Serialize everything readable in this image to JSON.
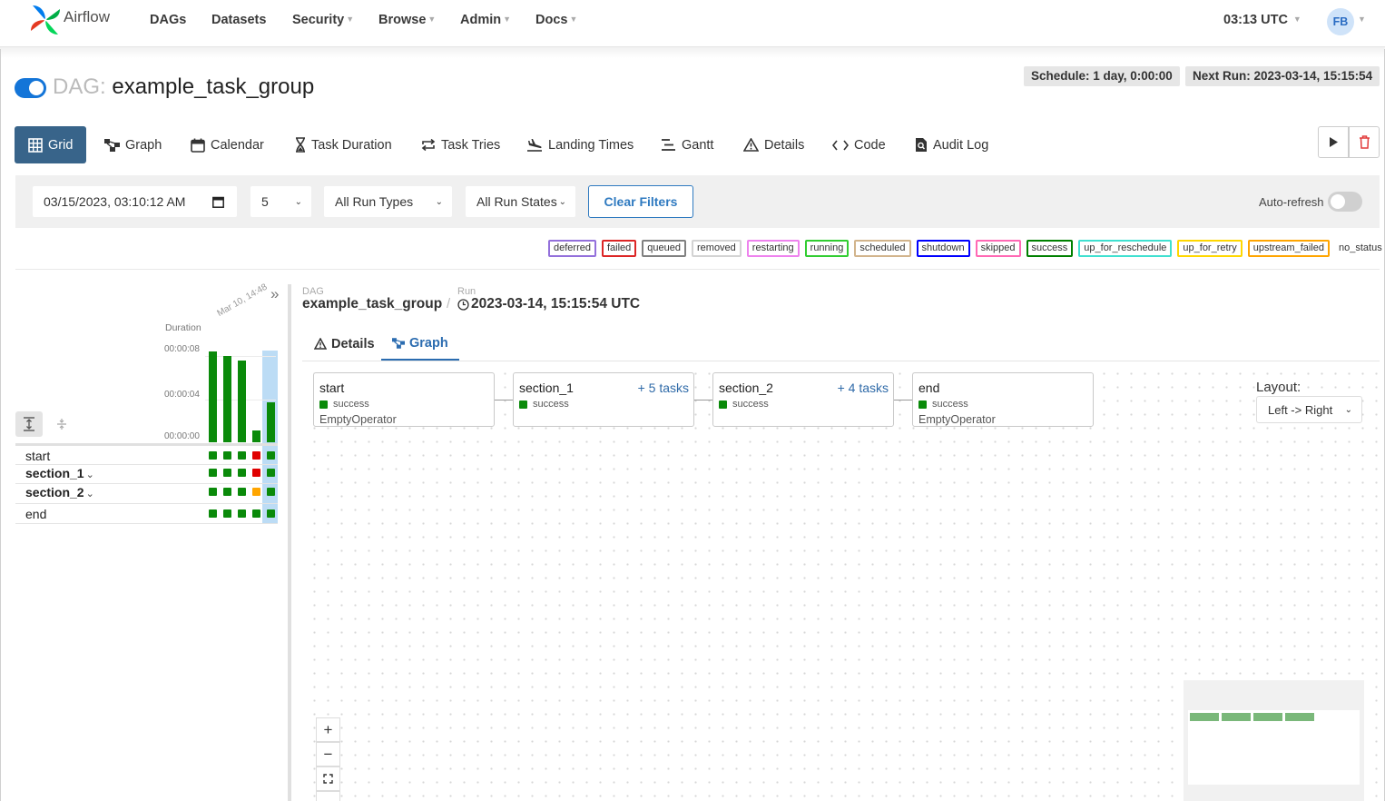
{
  "app": {
    "name": "Airflow",
    "nav": [
      "DAGs",
      "Datasets",
      "Security",
      "Browse",
      "Admin",
      "Docs"
    ],
    "clock": "03:13 UTC",
    "user_initials": "FB"
  },
  "dag": {
    "prefix": "DAG:",
    "name": "example_task_group",
    "paused": false,
    "schedule": "Schedule: 1 day, 0:00:00",
    "next_run": "Next Run: 2023-03-14, 15:15:54"
  },
  "tabs": {
    "grid": "Grid",
    "graph": "Graph",
    "calendar": "Calendar",
    "task_duration": "Task Duration",
    "task_tries": "Task Tries",
    "landing_times": "Landing Times",
    "gantt": "Gantt",
    "details": "Details",
    "code": "Code",
    "audit_log": "Audit Log"
  },
  "filters": {
    "date": "03/15/2023, 03:10:12 AM",
    "num_runs": "5",
    "run_types": "All Run Types",
    "run_states": "All Run States",
    "clear": "Clear Filters",
    "autorefresh": "Auto-refresh",
    "autorefresh_on": false
  },
  "legend": [
    {
      "label": "deferred",
      "color": "#9370db"
    },
    {
      "label": "failed",
      "color": "#dc2626"
    },
    {
      "label": "queued",
      "color": "#808080"
    },
    {
      "label": "removed",
      "color": "#d3d3d3"
    },
    {
      "label": "restarting",
      "color": "#ee82ee"
    },
    {
      "label": "running",
      "color": "#32cd32"
    },
    {
      "label": "scheduled",
      "color": "#d2b48c"
    },
    {
      "label": "shutdown",
      "color": "#0000ff"
    },
    {
      "label": "skipped",
      "color": "#ff69b4"
    },
    {
      "label": "success",
      "color": "#008000"
    },
    {
      "label": "up_for_reschedule",
      "color": "#40e0d0"
    },
    {
      "label": "up_for_retry",
      "color": "#ffd700"
    },
    {
      "label": "upstream_failed",
      "color": "#ffa500"
    },
    {
      "label": "no_status",
      "color": ""
    }
  ],
  "grid": {
    "duration_label": "Duration",
    "date_label": "Mar 10, 14:48",
    "ticks": [
      "00:00:08",
      "00:00:04",
      "00:00:00"
    ],
    "run_durations_sec": [
      8,
      7.6,
      7.2,
      1.0,
      3.5
    ],
    "rows": [
      {
        "label": "start",
        "group": false,
        "states": [
          "success",
          "success",
          "success",
          "failed",
          "success"
        ]
      },
      {
        "label": "section_1",
        "group": true,
        "states": [
          "success",
          "success",
          "success",
          "failed",
          "success"
        ]
      },
      {
        "label": "section_2",
        "group": true,
        "states": [
          "success",
          "success",
          "success",
          "upstream_failed",
          "success"
        ]
      },
      {
        "label": "end",
        "group": false,
        "states": [
          "success",
          "success",
          "success",
          "success",
          "success"
        ]
      }
    ]
  },
  "detail": {
    "dag_small": "DAG",
    "dag_name": "example_task_group",
    "run_small": "Run",
    "run_name": "2023-03-14, 15:15:54 UTC",
    "tab_details": "Details",
    "tab_graph": "Graph"
  },
  "graph": {
    "nodes": [
      {
        "name": "start",
        "status": "success",
        "operator": "EmptyOperator",
        "tasks": ""
      },
      {
        "name": "section_1",
        "status": "success",
        "operator": "",
        "tasks": "+ 5 tasks"
      },
      {
        "name": "section_2",
        "status": "success",
        "operator": "",
        "tasks": "+ 4 tasks"
      },
      {
        "name": "end",
        "status": "success",
        "operator": "EmptyOperator",
        "tasks": ""
      }
    ],
    "layout_label": "Layout:",
    "layout_value": "Left -> Right"
  },
  "colors": {
    "success": "#0a8a0a",
    "failed": "#e00000",
    "upstream_failed": "#ffa500",
    "accent": "#38648a",
    "link": "#2b6cb0"
  }
}
